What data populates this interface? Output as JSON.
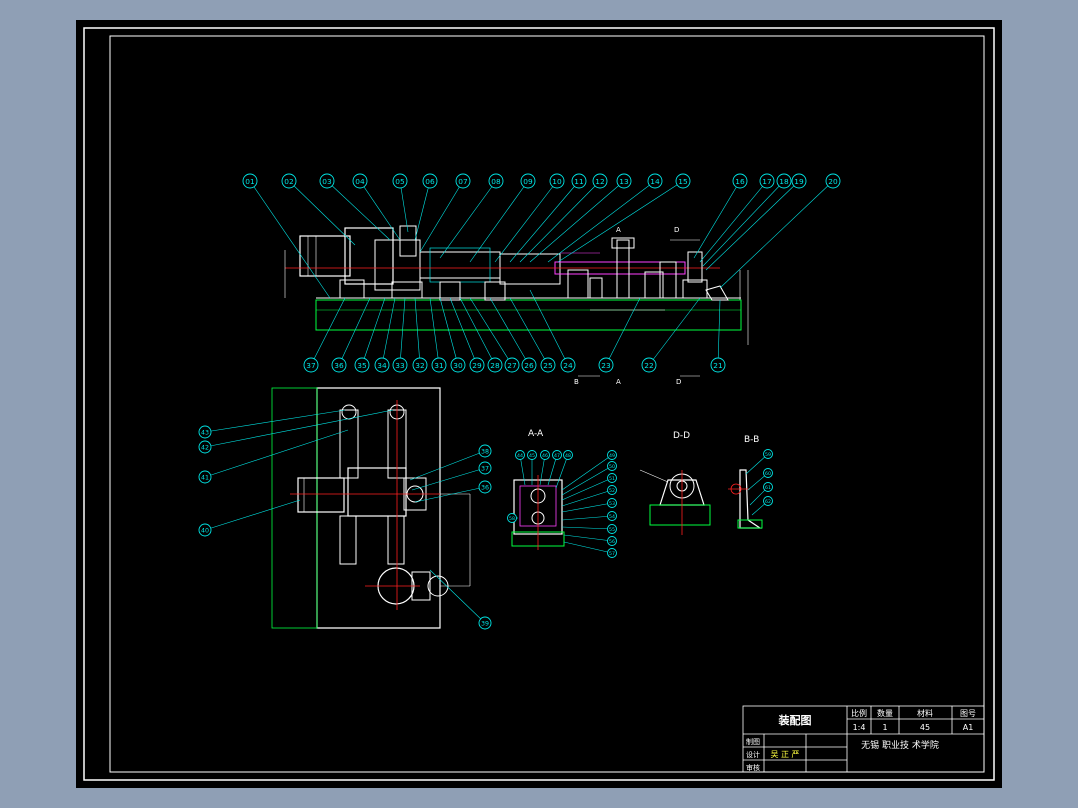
{
  "colors": {
    "background": "#8f9fb5",
    "paper": "#000000",
    "frame": "#ffffff",
    "balloon": "#00e5e5",
    "part": "#ffffff",
    "centerline": "#ff2020",
    "hidden": "#ff40ff",
    "hatch": "#00ff40",
    "title_text": "#ffff40"
  },
  "balloons": {
    "top_row": [
      "01",
      "02",
      "03",
      "04",
      "05",
      "06",
      "07",
      "08",
      "09",
      "10",
      "11",
      "12",
      "13",
      "14",
      "15",
      "16",
      "17",
      "18",
      "19",
      "20"
    ],
    "bottom_row": [
      "37",
      "36",
      "35",
      "34",
      "33",
      "32",
      "31",
      "30",
      "29",
      "28",
      "27",
      "26",
      "25",
      "24",
      "23",
      "22",
      "21"
    ],
    "plan_left": [
      "43",
      "42",
      "41",
      "40"
    ],
    "plan_right": [
      "38",
      "37",
      "36",
      "39"
    ],
    "section_aa_top": [
      "44",
      "45",
      "46",
      "47",
      "48"
    ],
    "section_aa_right": [
      "49",
      "50",
      "51",
      "52",
      "53",
      "54",
      "55",
      "56",
      "57"
    ],
    "section_aa_left": [
      "58"
    ],
    "section_bb": [
      "59",
      "60",
      "61",
      "62"
    ]
  },
  "section_labels": {
    "aa": "A-A",
    "dd": "D-D",
    "bb": "B-B",
    "a": "A",
    "b": "B",
    "d": "D"
  },
  "title_block": {
    "drawing_name": "装配图",
    "col1_header": "比例",
    "col2_header": "数量",
    "col3_header": "材料",
    "col4_header": "图号",
    "scale": "1:4",
    "quantity": "1",
    "material": "45",
    "drawing_number": "A1",
    "row_draw": "制图",
    "row_design": "设计",
    "row_review": "审核",
    "designer": "吴 正 严",
    "school": "无锡 职业技 术学院"
  }
}
